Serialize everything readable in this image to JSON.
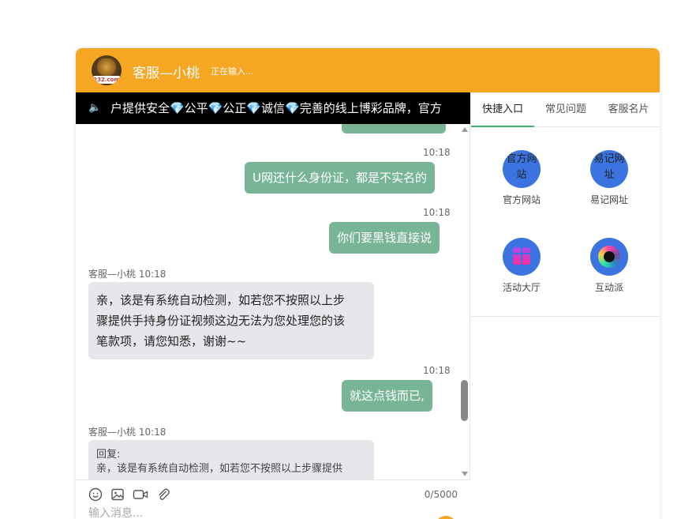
{
  "header": {
    "logo_text": "232.com",
    "agent_name": "客服—小桃",
    "status": "正在输入..."
  },
  "ticker": {
    "text": "户提供安全💎公平💎公正💎诚信💎完善的线上博彩品牌，官方"
  },
  "messages": [
    {
      "type": "me",
      "time": "10:18",
      "text": "U网还什么身份证，都是不实名的"
    },
    {
      "type": "me",
      "time": "10:18",
      "text": "你们要黑钱直接说"
    },
    {
      "type": "them",
      "meta": "客服—小桃 10:18",
      "lines": [
        "亲，该是有系统自动检测，如若您不按照以上步",
        "骤提供手持身份证视频这边无法为您处理您的该",
        "笔款项，请您知悉，谢谢~~"
      ]
    },
    {
      "type": "me",
      "time": "10:18",
      "text": "就这点钱而已,"
    },
    {
      "type": "them",
      "meta": "客服—小桃 10:18",
      "reply_label": "回复:",
      "reply_text": "亲，该是有系统自动检测，如若您不按照以上步骤提供"
    }
  ],
  "input": {
    "placeholder": "输入消息...",
    "char_count": "0/5000"
  },
  "side": {
    "tabs": [
      "快捷入口",
      "常见问题",
      "客服名片"
    ],
    "shortcuts": [
      {
        "label": "官方网站",
        "icon_alt": "官方网站"
      },
      {
        "label": "易记网址",
        "icon_alt": "易记网址"
      },
      {
        "label": "活动大厅",
        "icon": "gift-icon"
      },
      {
        "label": "互动派",
        "icon": "camera-icon"
      }
    ]
  },
  "colors": {
    "header": "#f5a623",
    "my_bubble": "#78b597",
    "their_bubble": "#e6e7eb",
    "tab_active": "#3cb371",
    "icon_bg": "#3b74e0"
  }
}
